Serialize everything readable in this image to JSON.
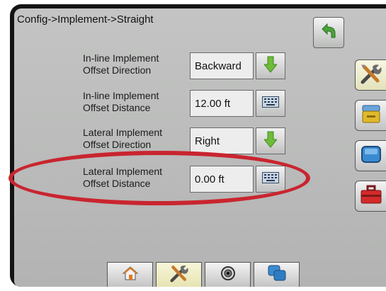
{
  "breadcrumb": "Config->Implement->Straight",
  "rows": [
    {
      "label_line1": "In-line Implement",
      "label_line2": "Offset Direction",
      "value": "Backward",
      "control": "down-arrow"
    },
    {
      "label_line1": "In-line Implement",
      "label_line2": "Offset Distance",
      "value": "12.00 ft",
      "control": "keyboard"
    },
    {
      "label_line1": "Lateral Implement",
      "label_line2": "Offset Direction",
      "value": "Right",
      "control": "down-arrow"
    },
    {
      "label_line1": "Lateral Implement",
      "label_line2": "Offset Distance",
      "value": "0.00 ft",
      "control": "keyboard"
    }
  ],
  "icons": {
    "back": "back-arrow-icon",
    "side_tabs": [
      "tools-icon",
      "console-icon",
      "display-icon",
      "toolbox-icon"
    ],
    "bottom_tabs": [
      "home-icon",
      "tools-icon",
      "gps-icon",
      "guidance-icon"
    ]
  },
  "colors": {
    "screen_bg": "#b5b6b5",
    "highlight": "#c9252f",
    "arrow_green": "#6fbb3a",
    "active_tab": "#ebe9c2"
  },
  "state": {
    "active_side_tab": "tools",
    "active_bottom_tab": "tools",
    "highlighted_row": 4
  }
}
